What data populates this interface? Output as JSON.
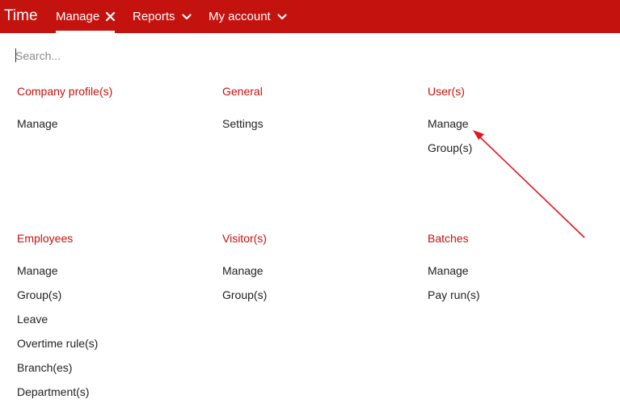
{
  "header": {
    "brand": "Time",
    "nav": [
      {
        "label": "Manage",
        "icon": "close-icon"
      },
      {
        "label": "Reports",
        "icon": "chevron-down-icon"
      },
      {
        "label": "My account",
        "icon": "chevron-down-icon"
      }
    ],
    "accent_color": "#c4120e"
  },
  "search": {
    "placeholder": "Search...",
    "value": ""
  },
  "sections": {
    "company": {
      "title": "Company profile(s)",
      "items": [
        "Manage"
      ]
    },
    "general": {
      "title": "General",
      "items": [
        "Settings"
      ]
    },
    "users": {
      "title": "User(s)",
      "items": [
        "Manage",
        "Group(s)"
      ]
    },
    "employees": {
      "title": "Employees",
      "items": [
        "Manage",
        "Group(s)",
        "Leave",
        "Overtime rule(s)",
        "Branch(es)",
        "Department(s)"
      ]
    },
    "visitors": {
      "title": "Visitor(s)",
      "items": [
        "Manage",
        "Group(s)"
      ]
    },
    "batches": {
      "title": "Batches",
      "items": [
        "Manage",
        "Pay run(s)"
      ]
    }
  },
  "annotation": {
    "color": "#e8141b",
    "icon": "annotation-arrow"
  }
}
